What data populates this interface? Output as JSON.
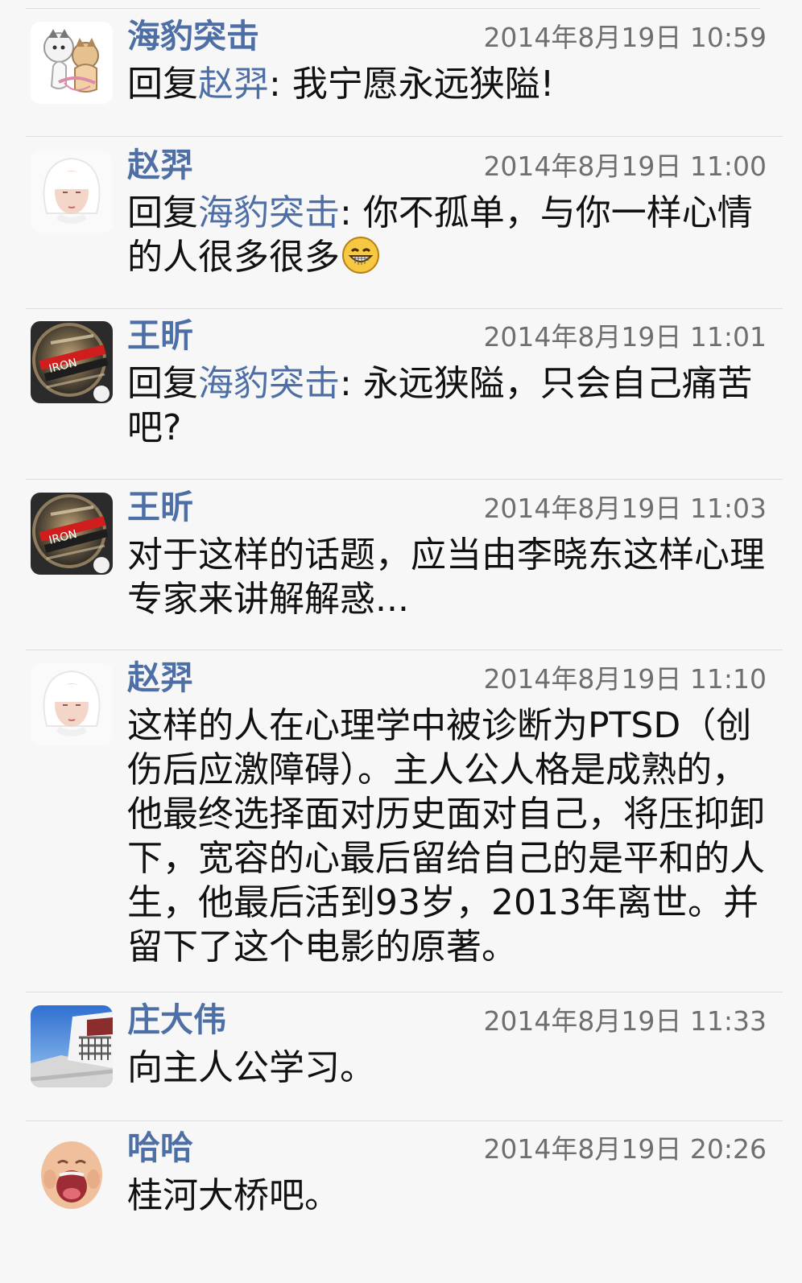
{
  "comments": [
    {
      "author": "海豹突击",
      "time": "2014年8月19日 10:59",
      "reply_prefix": "回复",
      "reply_to": "赵羿",
      "reply_colon": ": ",
      "text": "我宁愿永远狭隘!",
      "avatar_icon": "cat-avatar-icon"
    },
    {
      "author": "赵羿",
      "time": "2014年8月19日 11:00",
      "reply_prefix": "回复",
      "reply_to": "海豹突击",
      "reply_colon": ": ",
      "text": "你不孤单，与你一样心情的人很多很多",
      "emoji": "grinning-face-emoji",
      "avatar_icon": "white-hair-woman-avatar-icon"
    },
    {
      "author": "王昕",
      "time": "2014年8月19日 11:01",
      "reply_prefix": "回复",
      "reply_to": "海豹突击",
      "reply_colon": ": ",
      "text": "永远狭隘，只会自己痛苦吧?",
      "avatar_icon": "ironman-medal-avatar-icon"
    },
    {
      "author": "王昕",
      "time": "2014年8月19日 11:03",
      "text": "对于这样的话题，应当由李晓东这样心理专家来讲解解惑...",
      "avatar_icon": "ironman-medal-avatar-icon"
    },
    {
      "author": "赵羿",
      "time": "2014年8月19日 11:10",
      "text": "这样的人在心理学中被诊断为PTSD（创伤后应激障碍）。主人公人格是成熟的，他最终选择面对历史面对自己，将压抑卸下，宽容的心最后留给自己的是平和的人生，他最后活到93岁，2013年离世。并留下了这个电影的原著。",
      "avatar_icon": "white-hair-woman-avatar-icon"
    },
    {
      "author": "庄大伟",
      "time": "2014年8月19日 11:33",
      "text": "向主人公学习。",
      "avatar_icon": "palace-photo-avatar-icon"
    },
    {
      "author": "哈哈",
      "time": "2014年8月19日 20:26",
      "text": "桂河大桥吧。",
      "avatar_icon": "laughing-baby-avatar-icon"
    }
  ],
  "colors": {
    "background": "#f7f7f7",
    "author": "#4d6fa6",
    "timestamp": "#6f6f6f",
    "body_text": "#111111",
    "divider": "#dddddd"
  }
}
